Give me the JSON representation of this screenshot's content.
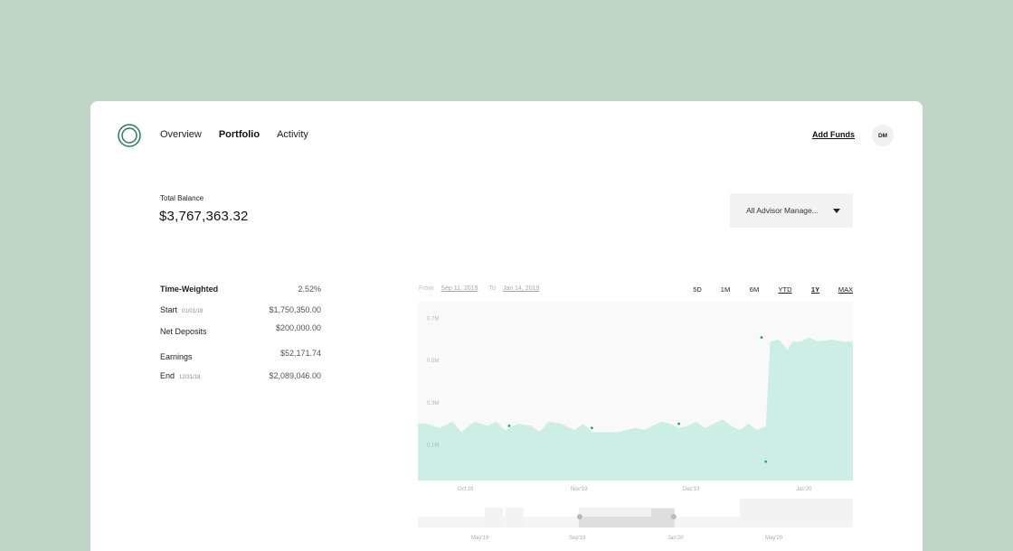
{
  "nav": {
    "items": [
      {
        "label": "Overview",
        "active": false
      },
      {
        "label": "Portfolio",
        "active": true
      },
      {
        "label": "Activity",
        "active": false
      }
    ],
    "add_funds": "Add Funds",
    "avatar_initials": "DM"
  },
  "balance": {
    "label": "Total Balance",
    "value": "$3,767,363.32"
  },
  "account_select": {
    "value": "All Advisor Manage..."
  },
  "stats": [
    {
      "label": "Time-Weighted",
      "date": "",
      "value": "2.52%"
    },
    {
      "label": "Start",
      "date": "01/01/18",
      "value": "$1,750,350.00"
    },
    {
      "label": "Net Deposits",
      "date": "",
      "value": "$200,000.00"
    },
    {
      "label": "Earnings",
      "date": "",
      "value": "$52,171.74"
    },
    {
      "label": "End",
      "date": "12/31/18",
      "value": "$2,089,046.00"
    }
  ],
  "range": {
    "from_label": "From",
    "from_value": "Sep 11, 2019",
    "to_label": "To",
    "to_value": "Jan 14, 2019"
  },
  "periods": [
    "5D",
    "1M",
    "6M",
    "YTD",
    "1Y",
    "MAX"
  ],
  "selected_period": "1Y",
  "colors": {
    "background": "#c0d5c8",
    "area_fill": "#cdeee5",
    "marker": "#1aa784",
    "brush_window": "#dedede"
  },
  "chart_data": {
    "type": "area",
    "y_tick_labels": [
      "0.7M",
      "0.5M",
      "0.3M",
      "0.1M"
    ],
    "y_ticks": [
      0.7,
      0.5,
      0.3,
      0.1
    ],
    "ylim": [
      -0.07,
      0.78
    ],
    "x_tick_labels": [
      "Oct'19",
      "Nov'19",
      "Dec'19",
      "Jan'20"
    ],
    "grid": false,
    "x": [
      0,
      0.02,
      0.05,
      0.08,
      0.1,
      0.13,
      0.16,
      0.18,
      0.2,
      0.23,
      0.26,
      0.28,
      0.3,
      0.33,
      0.36,
      0.38,
      0.4,
      0.42,
      0.44,
      0.46,
      0.48,
      0.5,
      0.52,
      0.54,
      0.56,
      0.58,
      0.6,
      0.62,
      0.64,
      0.66,
      0.68,
      0.7,
      0.72,
      0.74,
      0.76,
      0.78,
      0.8,
      0.81,
      0.83,
      0.85,
      0.86,
      0.88,
      0.9,
      0.92,
      0.95,
      0.98,
      1.0
    ],
    "values": [
      0.2,
      0.2,
      0.18,
      0.21,
      0.16,
      0.21,
      0.19,
      0.21,
      0.17,
      0.2,
      0.19,
      0.16,
      0.21,
      0.2,
      0.17,
      0.2,
      0.16,
      0.16,
      0.16,
      0.16,
      0.17,
      0.18,
      0.17,
      0.19,
      0.21,
      0.2,
      0.18,
      0.19,
      0.21,
      0.18,
      0.2,
      0.22,
      0.19,
      0.17,
      0.2,
      0.17,
      0.19,
      0.59,
      0.6,
      0.55,
      0.59,
      0.59,
      0.61,
      0.59,
      0.6,
      0.59,
      0.59
    ],
    "markers": [
      {
        "x": 0.21,
        "y": 0.19
      },
      {
        "x": 0.4,
        "y": 0.18
      },
      {
        "x": 0.6,
        "y": 0.2
      },
      {
        "x": 0.79,
        "y": 0.61
      },
      {
        "x": 0.8,
        "y": 0.02
      }
    ],
    "brush_tick_labels": [
      "May'19",
      "Sep'19",
      "Jan'20",
      "May'20"
    ],
    "brush_window": [
      0.37,
      0.59
    ]
  }
}
